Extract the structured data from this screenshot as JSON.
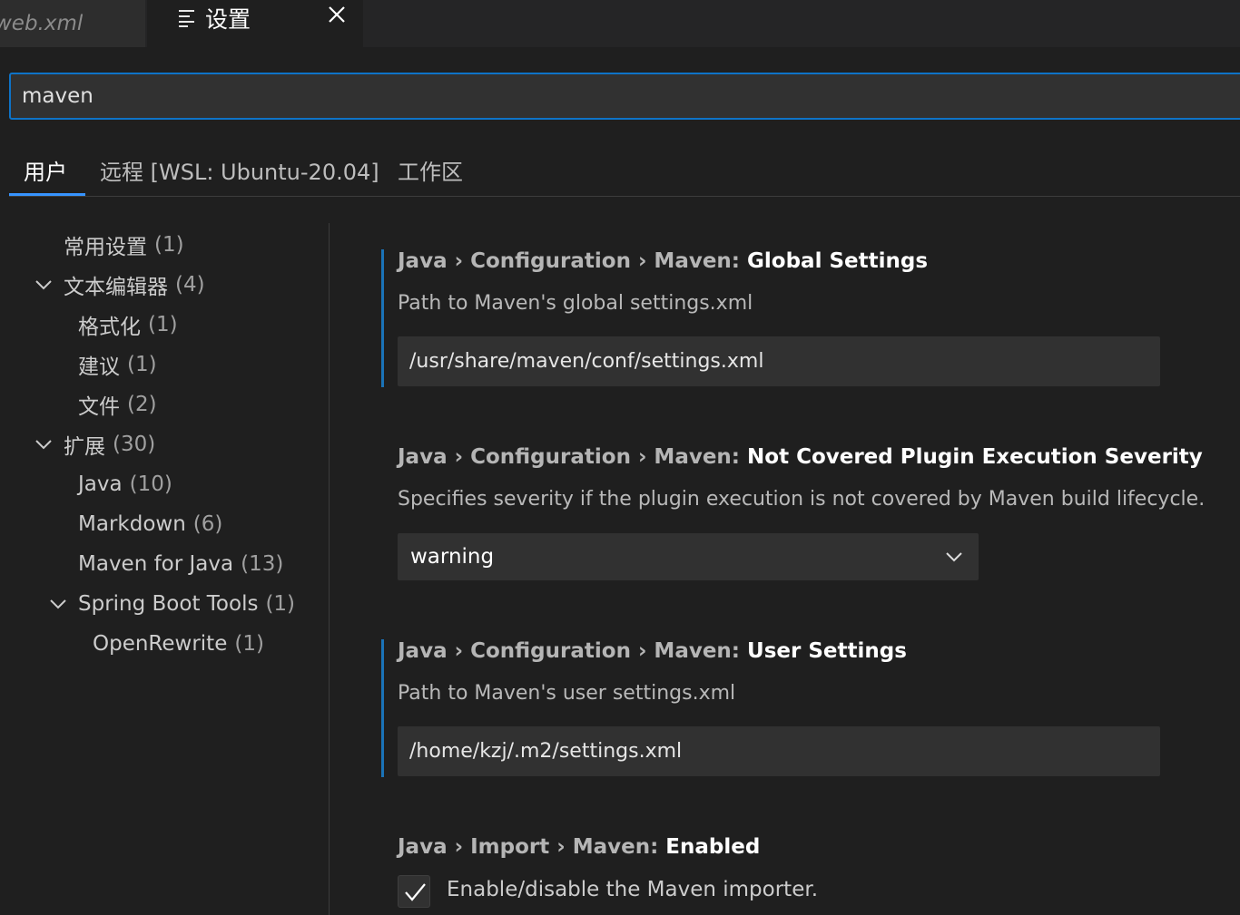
{
  "tabs": {
    "inactive_label": "web.xml",
    "active_label": "设置",
    "active_icon": "settings-lines-icon",
    "close_icon": "close-icon"
  },
  "search": {
    "value": "maven"
  },
  "scope_tabs": [
    {
      "label": "用户",
      "active": true
    },
    {
      "label": "远程 [WSL: Ubuntu-20.04]",
      "active": false
    },
    {
      "label": "工作区",
      "active": false
    }
  ],
  "tree": [
    {
      "label": "常用设置",
      "count": "(1)",
      "expanded": null
    },
    {
      "label": "文本编辑器",
      "count": "(4)",
      "expanded": true
    },
    {
      "label": "格式化",
      "count": "(1)",
      "expanded": null
    },
    {
      "label": "建议",
      "count": "(1)",
      "expanded": null
    },
    {
      "label": "文件",
      "count": "(2)",
      "expanded": null
    },
    {
      "label": "扩展",
      "count": "(30)",
      "expanded": true
    },
    {
      "label": "Java",
      "count": "(10)",
      "expanded": null
    },
    {
      "label": "Markdown",
      "count": "(6)",
      "expanded": null
    },
    {
      "label": "Maven for Java",
      "count": "(13)",
      "expanded": null
    },
    {
      "label": "Spring Boot Tools",
      "count": "(1)",
      "expanded": true
    },
    {
      "label": "OpenRewrite",
      "count": "(1)",
      "expanded": null
    }
  ],
  "settings": [
    {
      "category": "Java › Configuration › Maven: ",
      "name": "Global Settings",
      "description": "Path to Maven's global settings.xml",
      "value": "/usr/share/maven/conf/settings.xml",
      "modified": true
    },
    {
      "category": "Java › Configuration › Maven: ",
      "name": "Not Covered Plugin Execution Severity",
      "description": "Specifies severity if the plugin execution is not covered by Maven build lifecycle.",
      "value": "warning",
      "modified": false
    },
    {
      "category": "Java › Configuration › Maven: ",
      "name": "User Settings",
      "description": "Path to Maven's user settings.xml",
      "value": "/home/kzj/.m2/settings.xml",
      "modified": true
    },
    {
      "category": "Java › Import › Maven: ",
      "name": "Enabled",
      "description": "Enable/disable the Maven importer.",
      "checked": true,
      "modified": false
    }
  ],
  "colors": {
    "accent": "#3794ff",
    "modified_bar": "#1a73b8",
    "background": "#1f1f1f"
  }
}
